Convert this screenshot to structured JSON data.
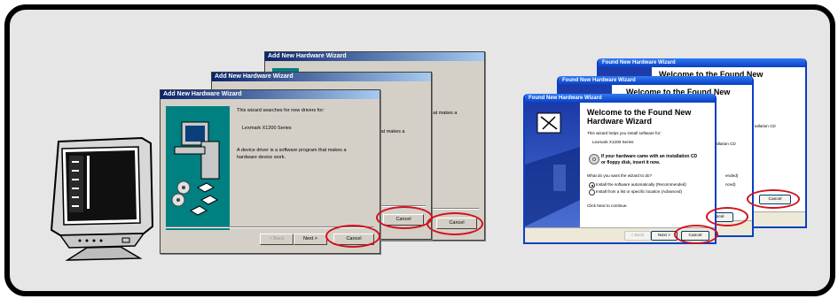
{
  "win98": {
    "title": "Add New Hardware Wizard",
    "line1": "This wizard searches for new drivers for:",
    "device": "Lexmark X1200 Series",
    "driver_line1": "A device driver is a software program that makes a",
    "driver_line2": "hardware device work.",
    "back_label": "< Back",
    "next_label": "Next >",
    "cancel_label": "Cancel",
    "behind_frag1": "that makes a",
    "behind_frag2": "that makes a"
  },
  "winxp": {
    "title": "Found New Hardware Wizard",
    "heading_line1": "Welcome to the Found New",
    "heading_line2": "Hardware Wizard",
    "help_line": "This wizard helps you install software for:",
    "device": "Lexmark X1200 Series",
    "cd_line1": "If your hardware came with an installation CD",
    "cd_line2": "or floppy disk, insert it now.",
    "question": "What do you want the wizard to do?",
    "option1": "Install the software automatically (Recommended)",
    "option2": "Install from a list or specific location (Advanced)",
    "continue": "Click Next to continue.",
    "back_label": "< Back",
    "next_label": "Next >",
    "cancel_label": "Cancel",
    "behind_frag1": "tallation CD",
    "behind_frag2": "ended)",
    "behind_frag3": "nced)"
  },
  "colors": {
    "highlight_oval": "#d4101c",
    "frame_bg": "#e6e6e6"
  }
}
